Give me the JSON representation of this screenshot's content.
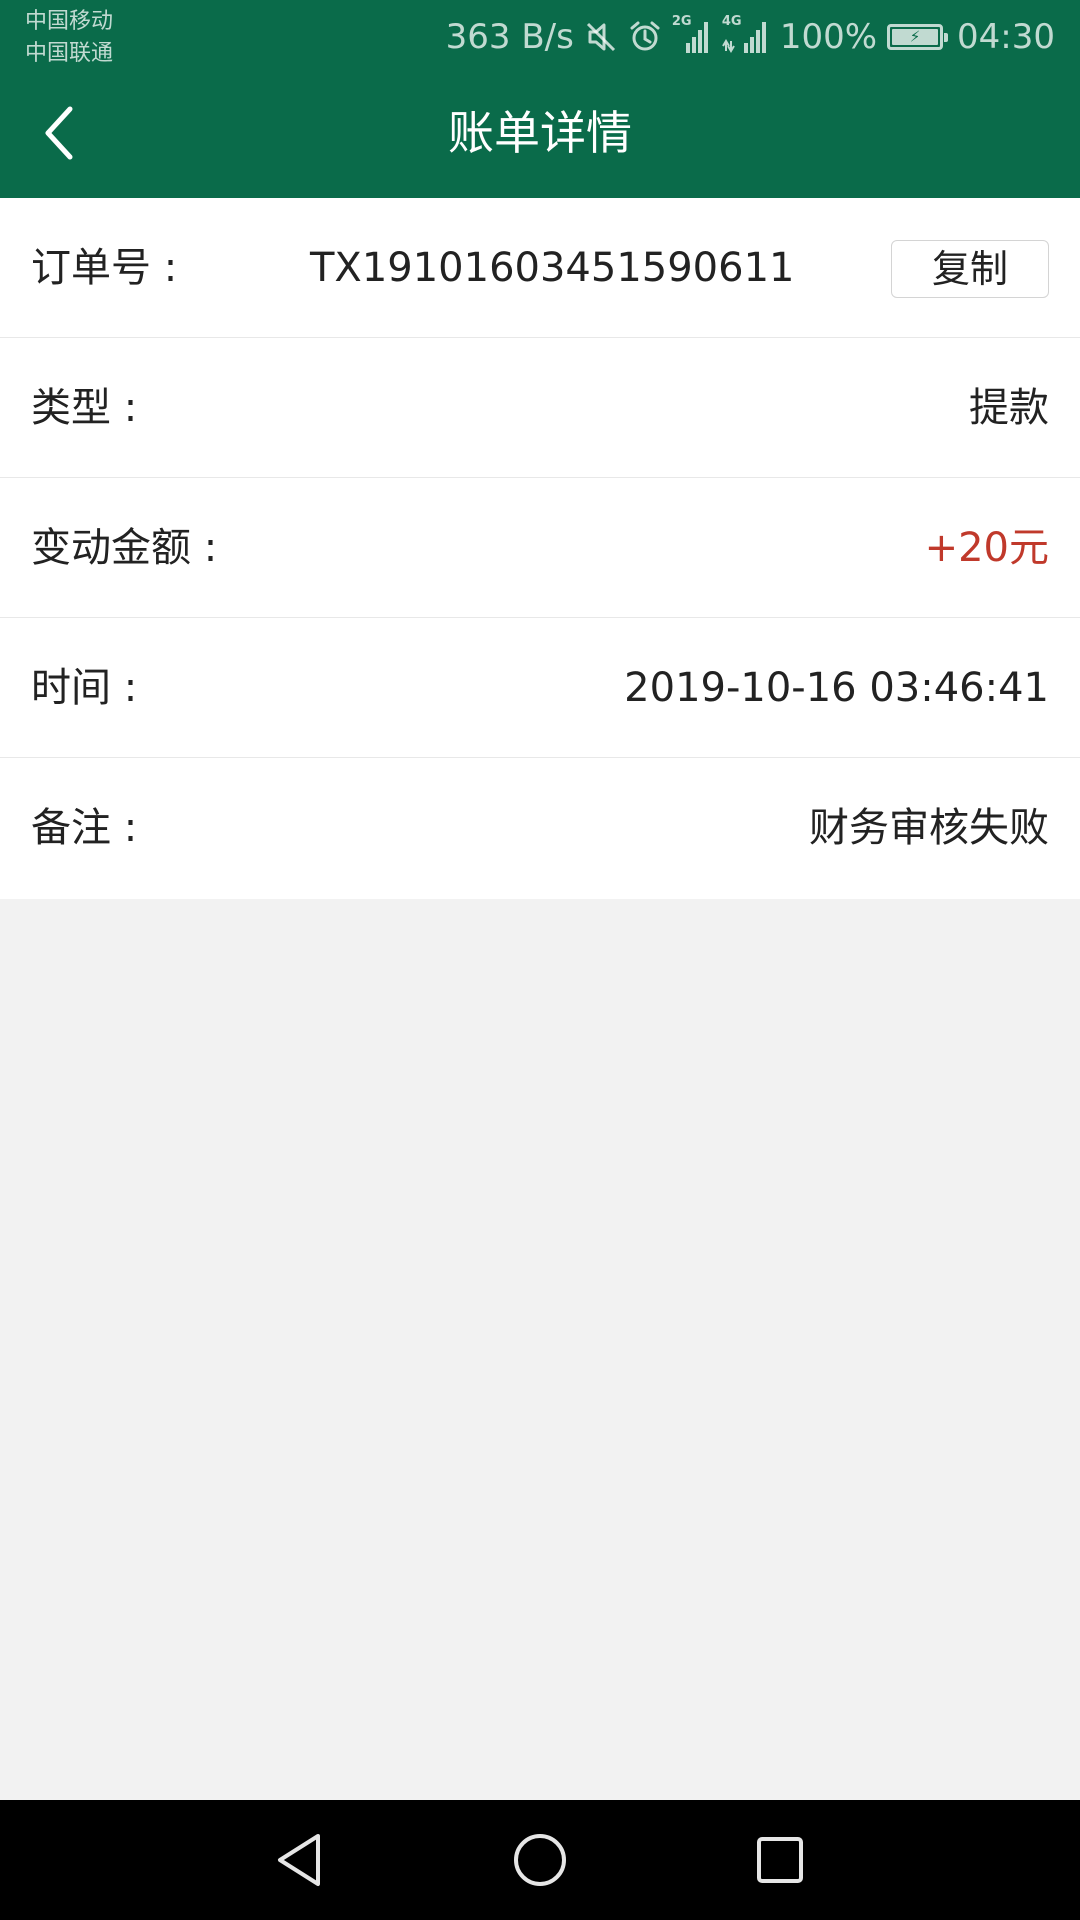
{
  "status_bar": {
    "carrier_1": "中国移动",
    "carrier_2": "中国联通",
    "net_speed": "363 B/s",
    "signal_1_tag": "2G",
    "signal_2_tag": "4G",
    "battery_percent": "100%",
    "battery_level": 1.0,
    "time": "04:30",
    "icons": [
      "mute-icon",
      "alarm-icon",
      "signal-icon",
      "battery-icon"
    ]
  },
  "header": {
    "title": "账单详情",
    "back_icon": "chevron-left-icon"
  },
  "details": {
    "order": {
      "label": "订单号 :",
      "value": "TX19101603451590611",
      "copy_label": "复制"
    },
    "type": {
      "label": "类型 :",
      "value": "提款"
    },
    "amount": {
      "label": "变动金额 :",
      "value": "+20元"
    },
    "time": {
      "label": "时间 :",
      "value": "2019-10-16 03:46:41"
    },
    "remark": {
      "label": "备注 :",
      "value": "财务审核失败"
    }
  },
  "colors": {
    "header_bg": "#0a6b4a",
    "amount_text": "#c0392b",
    "page_bg": "#f2f2f2",
    "nav_bg": "#000000"
  },
  "nav_bar": {
    "icons": [
      "back-triangle-icon",
      "home-circle-icon",
      "recents-square-icon"
    ]
  }
}
